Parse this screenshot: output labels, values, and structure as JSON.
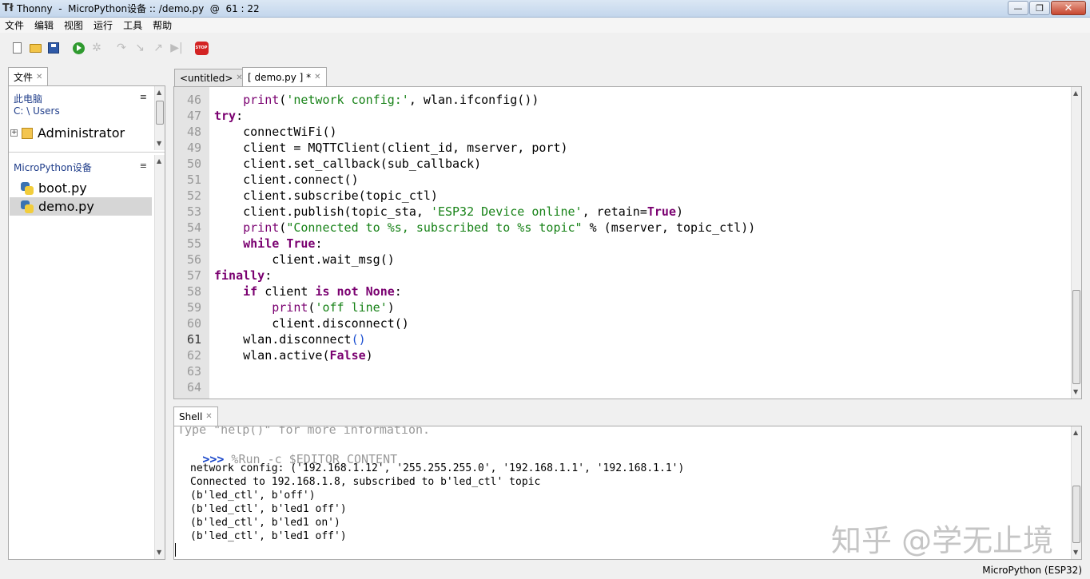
{
  "window": {
    "app_icon": "Tł",
    "title": "Thonny  -  MicroPython设备 :: /demo.py  @  61 : 22",
    "minimize_glyph": "—",
    "maximize_glyph": "❐",
    "close_glyph": "✕"
  },
  "menu": [
    "文件",
    "编辑",
    "视图",
    "运行",
    "工具",
    "帮助"
  ],
  "toolbar": {
    "icons": [
      "new-file-icon",
      "open-folder-icon",
      "save-icon",
      "run-icon",
      "debug-icon",
      "step-over-icon",
      "step-into-icon",
      "step-out-icon",
      "resume-icon",
      "stop-icon"
    ],
    "stop_label": "STOP",
    "disabled_glyphs": [
      "✲",
      "↷",
      "↘",
      "↗",
      "▶|"
    ]
  },
  "files_panel": {
    "tab_label": "文件",
    "this_pc_label": "此电脑",
    "this_pc_path": "C: \\ Users",
    "computer_items": [
      {
        "label": "Administrator",
        "expander": "+"
      }
    ],
    "device_label": "MicroPython设备",
    "device_items": [
      {
        "label": "boot.py",
        "selected": false
      },
      {
        "label": "demo.py",
        "selected": true
      }
    ],
    "menu_glyph": "≡"
  },
  "editor": {
    "tabs": [
      {
        "label": "<untitled>",
        "active": false
      },
      {
        "label": "[ demo.py ] *",
        "active": true
      }
    ],
    "current_line": 61,
    "lines": [
      {
        "n": "46",
        "code": "    print('network config:', wlan.ifconfig())"
      },
      {
        "n": "47",
        "code": "try:"
      },
      {
        "n": "48",
        "code": "    connectWiFi()"
      },
      {
        "n": "49",
        "code": "    client = MQTTClient(client_id, mserver, port)"
      },
      {
        "n": "50",
        "code": "    client.set_callback(sub_callback)"
      },
      {
        "n": "51",
        "code": "    client.connect()"
      },
      {
        "n": "52",
        "code": "    client.subscribe(topic_ctl)"
      },
      {
        "n": "53",
        "code": "    client.publish(topic_sta, 'ESP32 Device online', retain=True)"
      },
      {
        "n": "54",
        "code": "    print(\"Connected to %s, subscribed to %s topic\" % (mserver, topic_ctl))"
      },
      {
        "n": "55",
        "code": "    while True:"
      },
      {
        "n": "56",
        "code": "        client.wait_msg()"
      },
      {
        "n": "57",
        "code": "finally:"
      },
      {
        "n": "58",
        "code": "    if client is not None:"
      },
      {
        "n": "59",
        "code": "        print('off line')"
      },
      {
        "n": "60",
        "code": "        client.disconnect()"
      },
      {
        "n": "61",
        "code": "    wlan.disconnect()"
      },
      {
        "n": "62",
        "code": "    wlan.active(False)"
      },
      {
        "n": "63",
        "code": ""
      },
      {
        "n": "64",
        "code": ""
      }
    ]
  },
  "shell": {
    "tab_label": "Shell",
    "help_hint": "Type \"help()\" for more information.",
    "prompt": ">>>",
    "command": " %Run -c $EDITOR_CONTENT",
    "output": [
      "network config: ('192.168.1.12', '255.255.255.0', '192.168.1.1', '192.168.1.1')",
      "Connected to 192.168.1.8, subscribed to b'led_ctl' topic",
      "(b'led_ctl', b'off')",
      "(b'led_ctl', b'led1 off')",
      "(b'led_ctl', b'led1 on')",
      "(b'led_ctl', b'led1 off')"
    ]
  },
  "watermark": "知乎 @学无止境",
  "status": {
    "interpreter": "MicroPython (ESP32)"
  },
  "colors": {
    "keyword": "#7a0070",
    "string": "#178217",
    "prompt": "#1a47c9",
    "gutter": "#e4e4e4"
  }
}
